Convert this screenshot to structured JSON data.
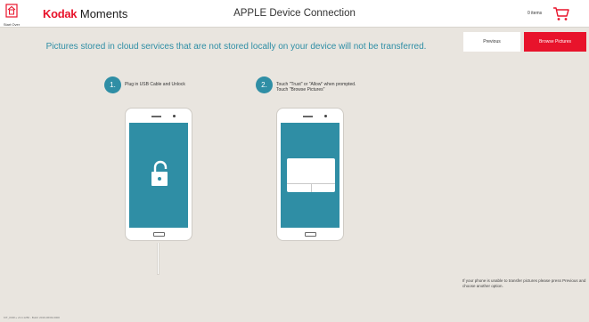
{
  "header": {
    "start_over_label": "Start Over",
    "brand_name": "Kodak",
    "brand_suffix": "Moments",
    "title": "APPLE Device Connection",
    "cart_count": "0 items"
  },
  "notice": "Pictures stored in cloud services that are not stored locally on your device will not be transferred.",
  "buttons": {
    "previous": "Previous",
    "browse": "Browse Pictures"
  },
  "steps": [
    {
      "number": "1.",
      "text": "Plug in USB Cable and Unlock"
    },
    {
      "number": "2.",
      "text_line1": "Touch \"Trust\" or \"Allow\" when prompted.",
      "text_line2": "Touch \"Browse Pictures\""
    }
  ],
  "footnote": "If your phone is unable to transfer pictures please press Previous and choose another option.",
  "build_info": "KIT_KDIK+ v3.4.1256 - Build: 2019-06/03-0000",
  "colors": {
    "accent": "#2f8ea5",
    "brand_red": "#e8132b",
    "background": "#e9e5df"
  },
  "icons": {
    "start_over": "home-icon",
    "cart": "cart-icon",
    "unlock": "unlock-icon"
  }
}
